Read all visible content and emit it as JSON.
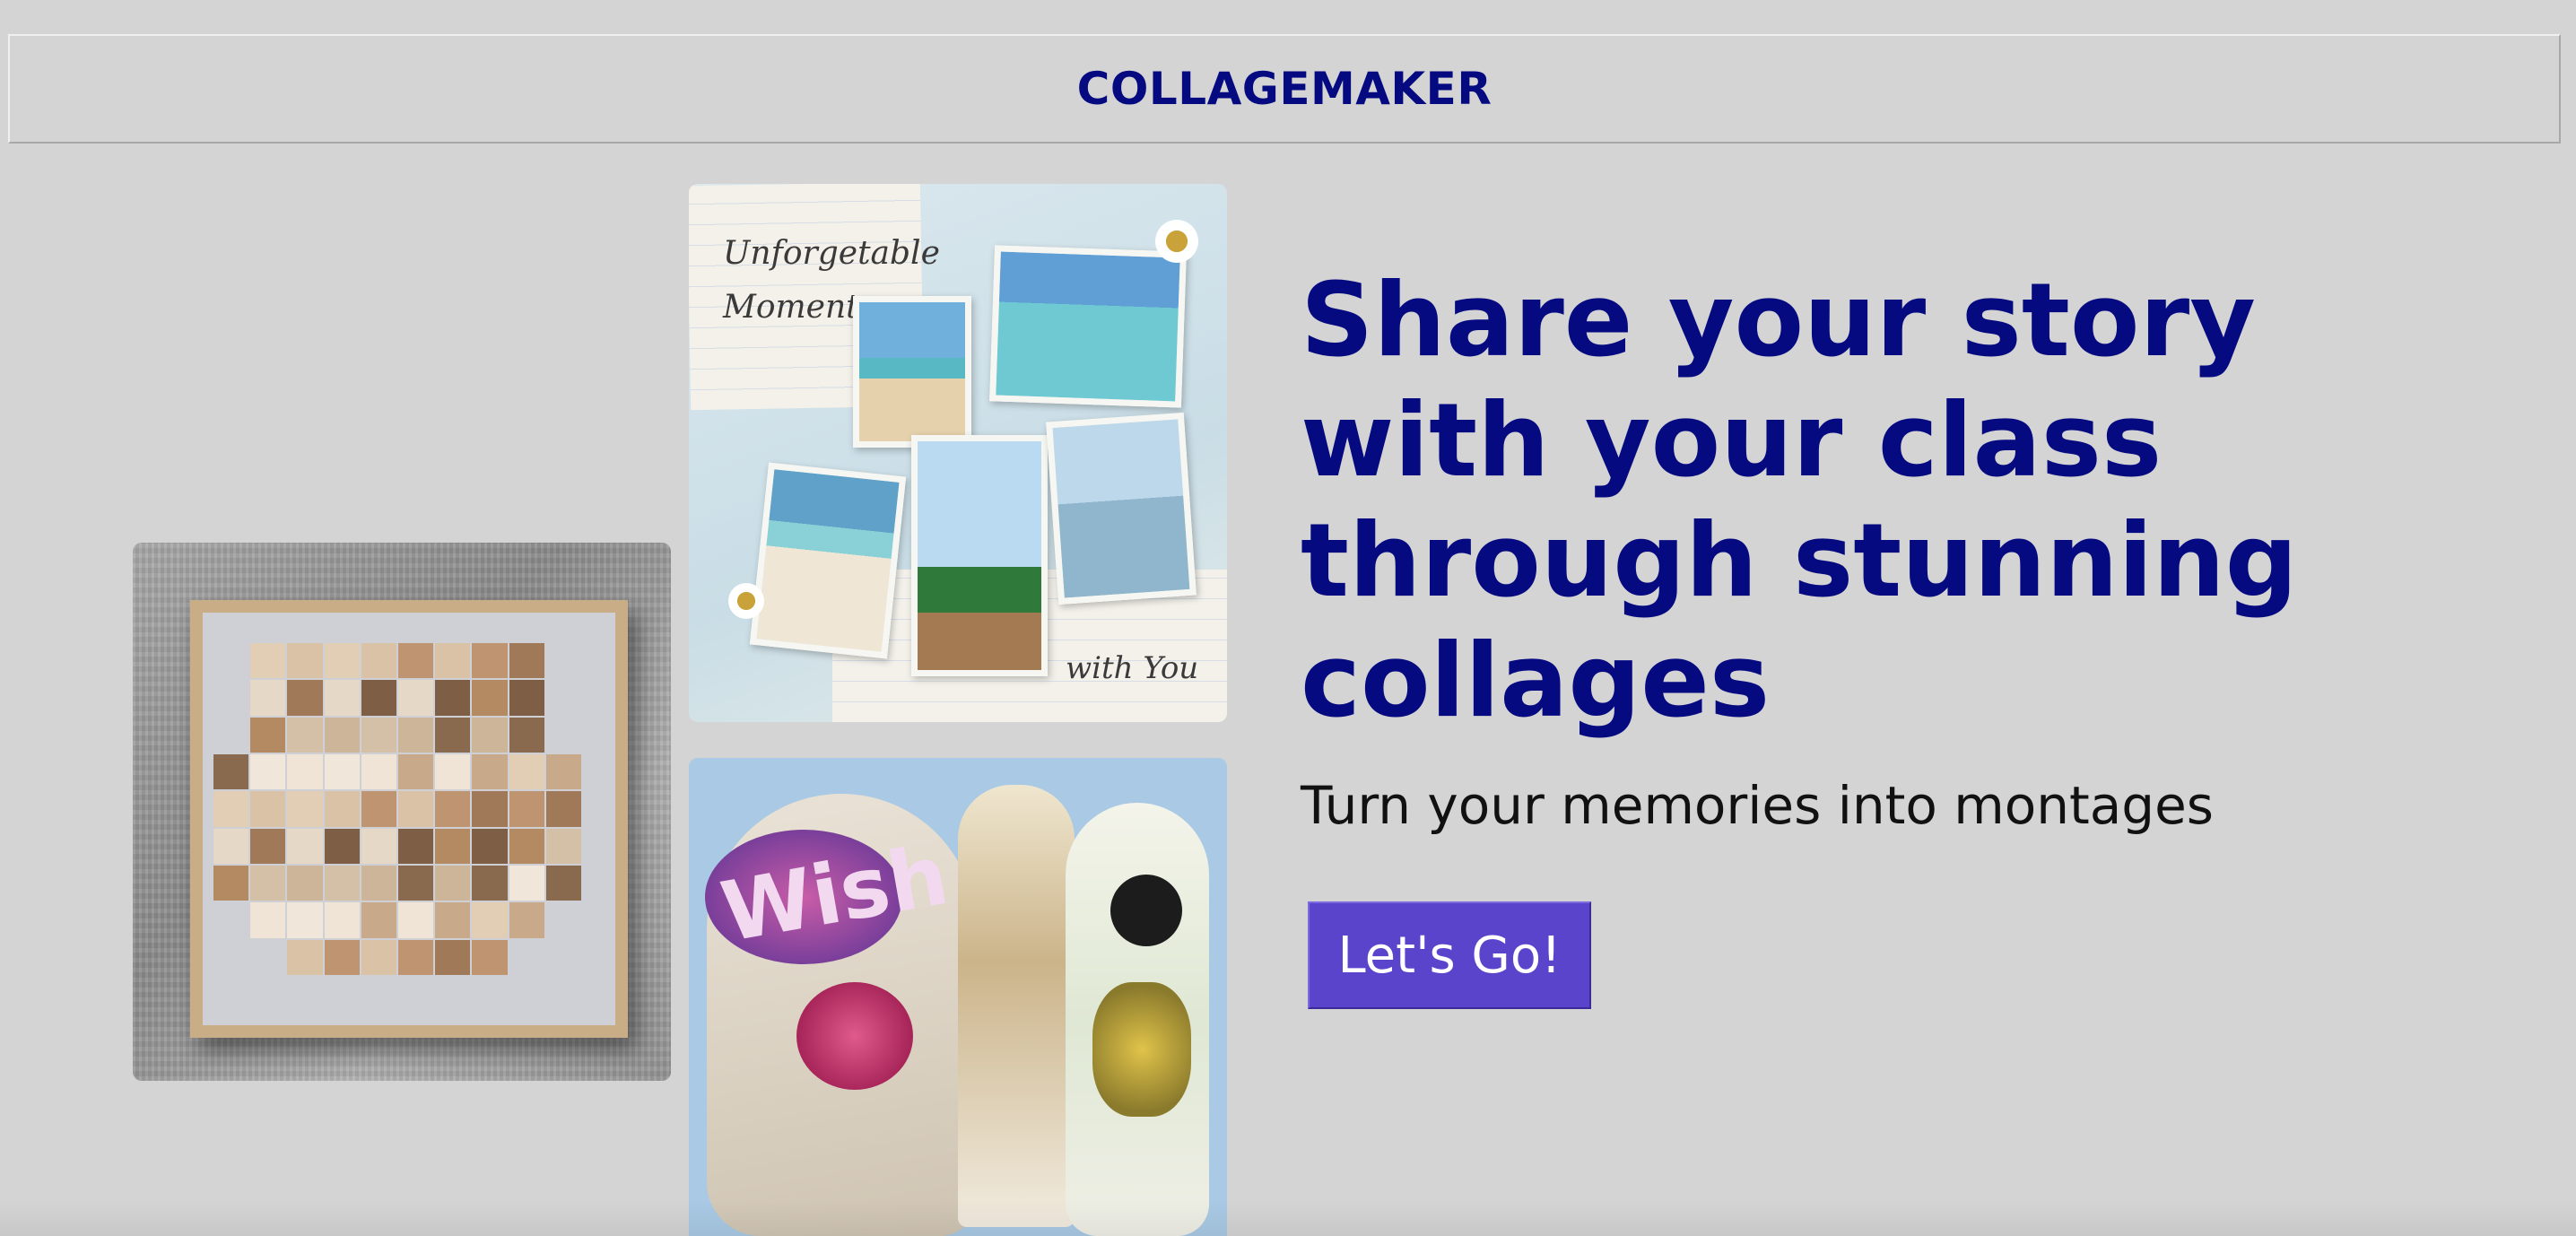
{
  "header": {
    "brand": "COLLAGEMAKER"
  },
  "gallery": {
    "moment_card_text_top": "Unforgetable Moment",
    "moment_card_text_bottom": "with You",
    "wish_card_text": "Wish"
  },
  "hero": {
    "headline": "Share your story with your class through stunning collages",
    "subline": "Turn your memories into montages",
    "cta_label": "Let's Go!"
  },
  "colors": {
    "background": "#d4d4d4",
    "brand": "#060a80",
    "cta": "#5a44cc"
  }
}
